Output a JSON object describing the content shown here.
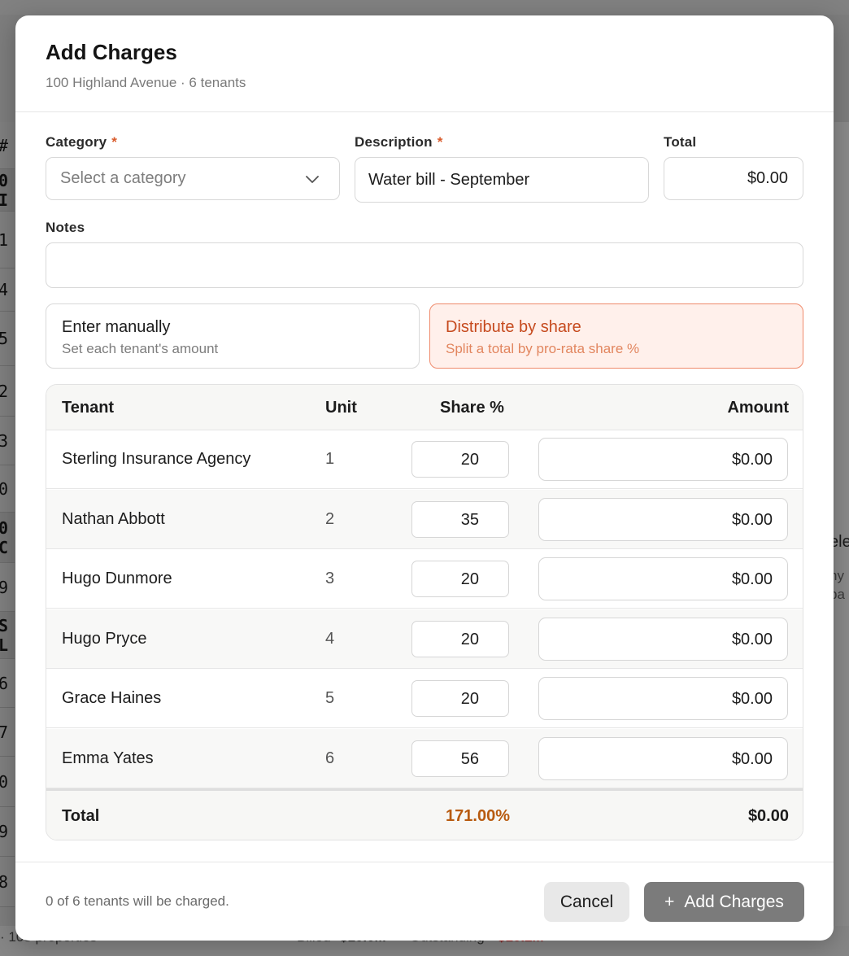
{
  "background": {
    "row_fragments": [
      "#",
      "0 I",
      "1",
      "4",
      "5",
      "2",
      "3",
      "0",
      "0 C",
      "9",
      "S L",
      "6",
      "7",
      "0",
      "9",
      "8"
    ],
    "right_fragments": [
      "ele",
      "ny",
      "pa"
    ],
    "footer": {
      "properties": "· 103 properties",
      "billed_label": "Billed",
      "billed_value": "$10.0M",
      "outstanding_label": "Outstanding",
      "outstanding_value": "$10.2M"
    }
  },
  "modal": {
    "title": "Add Charges",
    "subtitle": "100 Highland Avenue · 6 tenants",
    "form": {
      "category_label": "Category",
      "category_placeholder": "Select a category",
      "description_label": "Description",
      "description_value": "Water bill - September",
      "total_label": "Total",
      "total_value": "$0.00",
      "notes_label": "Notes",
      "notes_value": "",
      "required_mark": "*"
    },
    "modes": {
      "manual": {
        "title": "Enter manually",
        "desc": "Set each tenant's amount",
        "selected": false
      },
      "share": {
        "title": "Distribute by share",
        "desc": "Split a total by pro-rata share %",
        "selected": true
      }
    },
    "table": {
      "headers": {
        "tenant": "Tenant",
        "unit": "Unit",
        "share": "Share %",
        "amount": "Amount"
      },
      "rows": [
        {
          "tenant": "Sterling Insurance Agency",
          "unit": "1",
          "share": "20",
          "amount": "$0.00"
        },
        {
          "tenant": "Nathan Abbott",
          "unit": "2",
          "share": "35",
          "amount": "$0.00"
        },
        {
          "tenant": "Hugo Dunmore",
          "unit": "3",
          "share": "20",
          "amount": "$0.00"
        },
        {
          "tenant": "Hugo Pryce",
          "unit": "4",
          "share": "20",
          "amount": "$0.00"
        },
        {
          "tenant": "Grace Haines",
          "unit": "5",
          "share": "20",
          "amount": "$0.00"
        },
        {
          "tenant": "Emma Yates",
          "unit": "6",
          "share": "56",
          "amount": "$0.00"
        }
      ],
      "footer": {
        "label": "Total",
        "share_total": "171.00%",
        "amount_total": "$0.00"
      }
    },
    "footer": {
      "note": "0 of 6 tenants will be charged.",
      "cancel_label": "Cancel",
      "add_plus": "+",
      "add_label": "Add Charges"
    },
    "colors": {
      "accent": "#c64a1e",
      "share_total": "#b85b10",
      "selected_bg": "#fff0eb"
    }
  }
}
